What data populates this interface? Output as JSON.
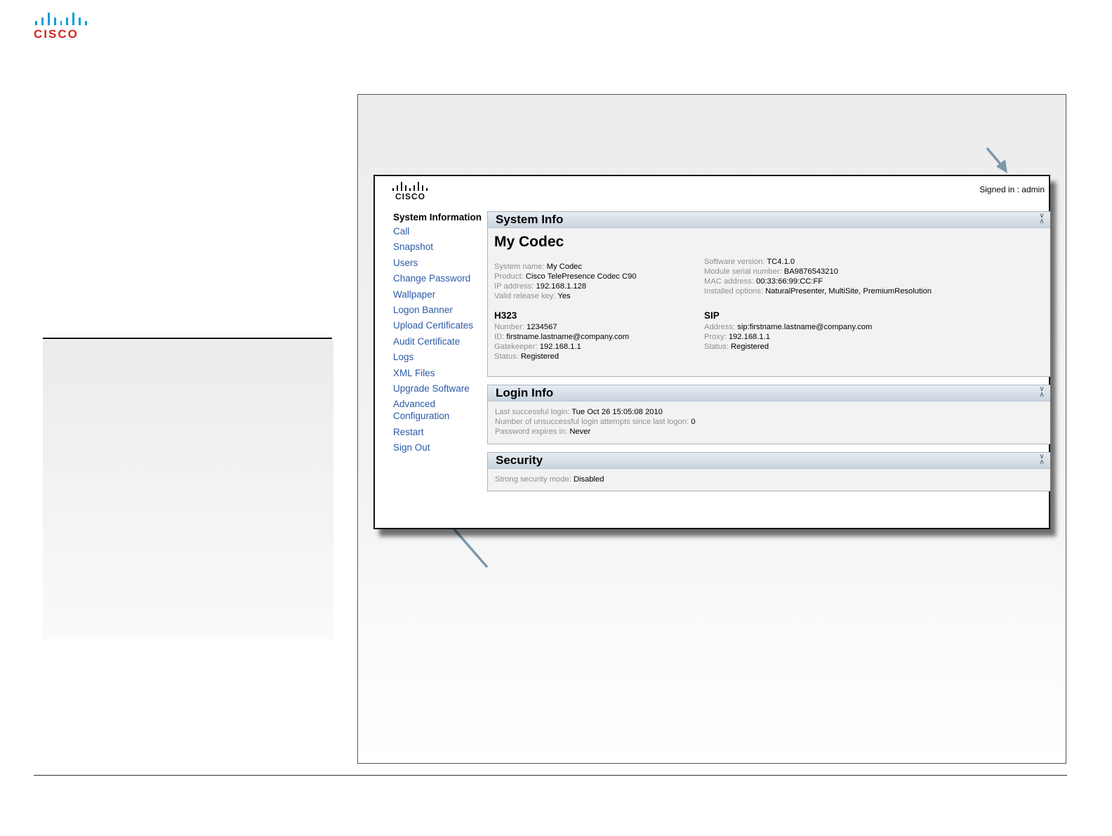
{
  "document": {
    "brand_text": "CISCO"
  },
  "app": {
    "brand_text": "CISCO",
    "signed_in": "Signed in : admin",
    "nav": [
      {
        "label": "System Information",
        "active": true
      },
      {
        "label": "Call"
      },
      {
        "label": "Snapshot"
      },
      {
        "label": "Users"
      },
      {
        "label": "Change Password"
      },
      {
        "label": "Wallpaper"
      },
      {
        "label": "Logon Banner"
      },
      {
        "label": "Upload Certificates"
      },
      {
        "label": "Audit Certificate"
      },
      {
        "label": "Logs"
      },
      {
        "label": "XML Files"
      },
      {
        "label": "Upgrade Software"
      },
      {
        "label": "Advanced Configuration"
      },
      {
        "label": "Restart"
      },
      {
        "label": "Sign Out"
      }
    ],
    "system_info": {
      "title": "System Info",
      "codec_name": "My Codec",
      "left": [
        {
          "label": "System name:",
          "value": "My Codec"
        },
        {
          "label": "Product:",
          "value": "Cisco TelePresence Codec C90"
        },
        {
          "label": "IP address:",
          "value": "192.168.1.128"
        },
        {
          "label": "Valid release key:",
          "value": "Yes"
        }
      ],
      "right": [
        {
          "label": "Software version:",
          "value": "TC4.1.0"
        },
        {
          "label": "Module serial number:",
          "value": "BA9876543210"
        },
        {
          "label": "MAC address:",
          "value": "00:33:66:99:CC:FF"
        },
        {
          "label": "Installed options:",
          "value": "NaturalPresenter, MultiSite, PremiumResolution"
        }
      ],
      "h323": {
        "title": "H323",
        "rows": [
          {
            "label": "Number:",
            "value": "1234567"
          },
          {
            "label": "ID:",
            "value": "firstname.lastname@company.com"
          },
          {
            "label": "Gatekeeper:",
            "value": "192.168.1.1"
          },
          {
            "label": "Status:",
            "value": "Registered"
          }
        ]
      },
      "sip": {
        "title": "SIP",
        "rows": [
          {
            "label": "Address:",
            "value": "sip:firstname.lastname@company.com"
          },
          {
            "label": "Proxy:",
            "value": "192.168.1.1"
          },
          {
            "label": "Status:",
            "value": "Registered"
          }
        ]
      }
    },
    "login_info": {
      "title": "Login Info",
      "rows": [
        {
          "label": "Last successful login:",
          "value": "Tue Oct 26 15:05:08 2010"
        },
        {
          "label": "Number of unsuccessful login attempts since last logon:",
          "value": "0"
        },
        {
          "label": "Password expires in:",
          "value": "Never"
        }
      ]
    },
    "security": {
      "title": "Security",
      "rows": [
        {
          "label": "Strong security mode:",
          "value": "Disabled"
        }
      ]
    }
  },
  "colors": {
    "cisco_blue": "#049fd9",
    "cisco_red": "#d0271d",
    "nav_link": "#2a5aa8",
    "annotation_arrow": "#7b98ab"
  }
}
